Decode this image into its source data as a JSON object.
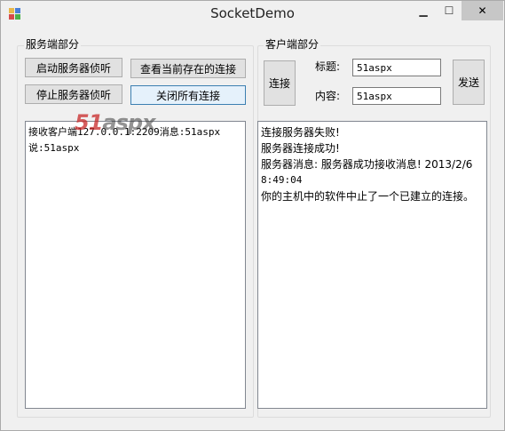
{
  "window": {
    "title": "SocketDemo",
    "controls": {
      "minimize": "▁",
      "maximize": "☐",
      "close": "✕"
    }
  },
  "server": {
    "group_label": "服务端部分",
    "start_btn": "启动服务器侦听",
    "view_btn": "查看当前存在的连接",
    "stop_btn": "停止服务器侦听",
    "close_all_btn": "关闭所有连接",
    "log_lines": [
      "接收客户端127.0.0.1:2209消息:51aspx",
      "说:51aspx"
    ]
  },
  "client": {
    "group_label": "客户端部分",
    "connect_btn": "连接",
    "title_label": "标题:",
    "title_value": "51aspx",
    "content_label": "内容:",
    "content_value": "51aspx",
    "send_btn": "发送",
    "log_lines": [
      "连接服务器失败!",
      "服务器连接成功!",
      "服务器消息: 服务器成功接收消息! 2013/2/6",
      "8:49:04",
      "你的主机中的软件中止了一个已建立的连接。"
    ]
  },
  "watermark": {
    "part1": "51",
    "part2": "aspx"
  }
}
